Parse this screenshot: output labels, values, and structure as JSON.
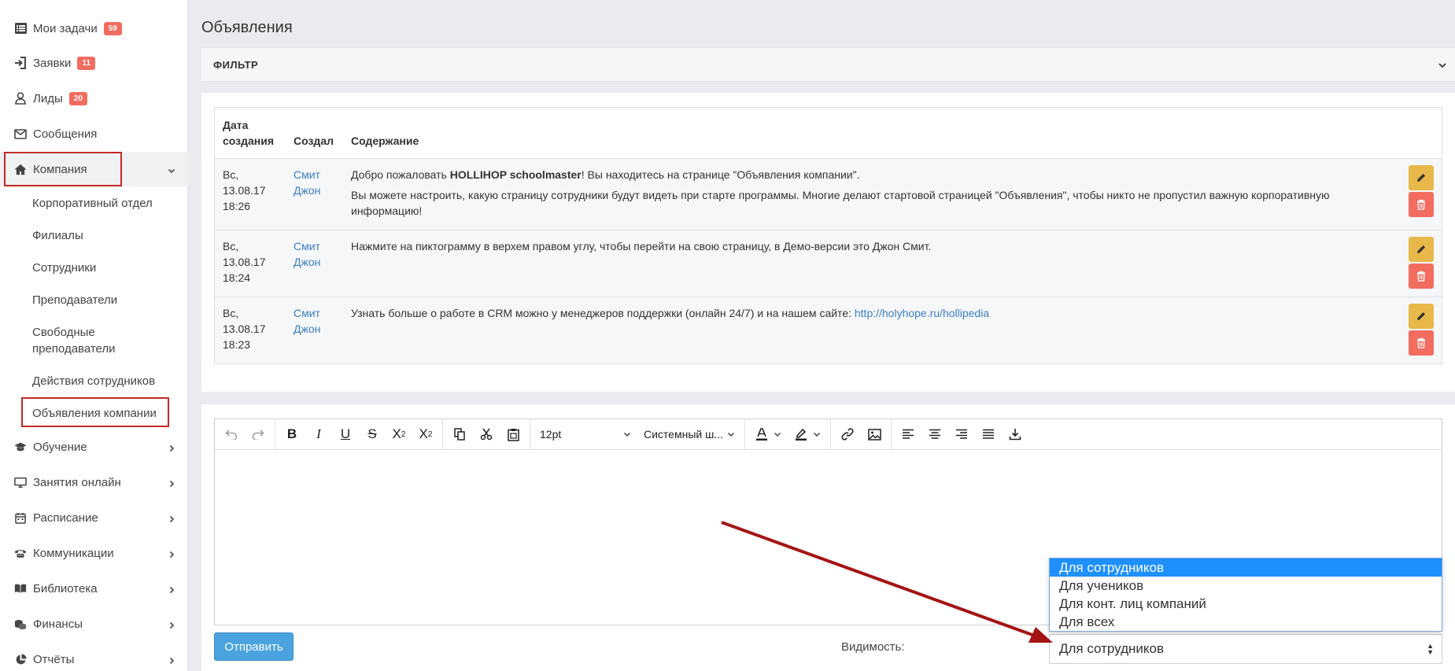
{
  "sidebar": {
    "items": [
      {
        "label": "Мои задачи",
        "badge": "59",
        "icon": "list-icon"
      },
      {
        "label": "Заявки",
        "badge": "11",
        "icon": "sign-in-icon"
      },
      {
        "label": "Лиды",
        "badge": "20",
        "icon": "user-icon"
      },
      {
        "label": "Сообщения",
        "icon": "envelope-icon"
      },
      {
        "label": "Компания",
        "icon": "home-icon"
      },
      {
        "label": "Обучение",
        "icon": "graduation-cap-icon"
      },
      {
        "label": "Занятия онлайн",
        "icon": "monitor-icon"
      },
      {
        "label": "Расписание",
        "icon": "calendar-icon"
      },
      {
        "label": "Коммуникации",
        "icon": "phone-icon"
      },
      {
        "label": "Библиотека",
        "icon": "book-icon"
      },
      {
        "label": "Финансы",
        "icon": "coins-icon"
      },
      {
        "label": "Отчёты",
        "icon": "pie-chart-icon"
      }
    ],
    "company_sub": [
      "Корпоративный отдел",
      "Филиалы",
      "Сотрудники",
      "Преподаватели",
      "Свободные преподаватели",
      "Действия сотрудников",
      "Объявления компании"
    ]
  },
  "page": {
    "title": "Объявления",
    "filter_label": "ФИЛЬТР"
  },
  "table": {
    "headers": [
      "Дата создания",
      "Создал",
      "Содержание"
    ],
    "rows": [
      {
        "date": "Вс, 13.08.17 18:26",
        "author": "Смит Джон",
        "p1_pre": "Добро пожаловать ",
        "p1_bold": "HOLLIHOP schoolmaster",
        "p1_post": "! Вы находитесь на странице \"Объявления компании\".",
        "p2": "Вы можете настроить, какую страницу сотрудники будут видеть при старте программы. Многие делают стартовой страницей \"Объявления\", чтобы никто не пропустил важную корпоративную информацию!"
      },
      {
        "date": "Вс, 13.08.17 18:24",
        "author": "Смит Джон",
        "text": "Нажмите на пиктограмму в верхем правом углу, чтобы перейти на свою страницу, в Демо-версии это Джон Смит."
      },
      {
        "date": "Вс, 13.08.17 18:23",
        "author": "Смит Джон",
        "text": "Узнать больше о работе в CRM можно у менеджеров поддержки (онлайн 24/7) и на нашем сайте: ",
        "link": "http://holyhope.ru/hollipedia"
      }
    ]
  },
  "editor": {
    "font_size": "12pt",
    "font_family": "Системный ш...",
    "send_label": "Отправить",
    "visibility_label": "Видимость:",
    "visibility_value": "Для сотрудников",
    "visibility_options": [
      "Для сотрудников",
      "Для учеников",
      "Для конт. лиц компаний",
      "Для всех"
    ]
  },
  "colors": {
    "badge": "#f36c60",
    "link": "#3a7fc3",
    "edit_button": "#e8b84a",
    "delete_button": "#f36c60",
    "send_button": "#4aa3df",
    "highlight_box": "#c62828",
    "annotation_arrow": "#a31515",
    "dropdown_selected": "#1e90ff"
  }
}
